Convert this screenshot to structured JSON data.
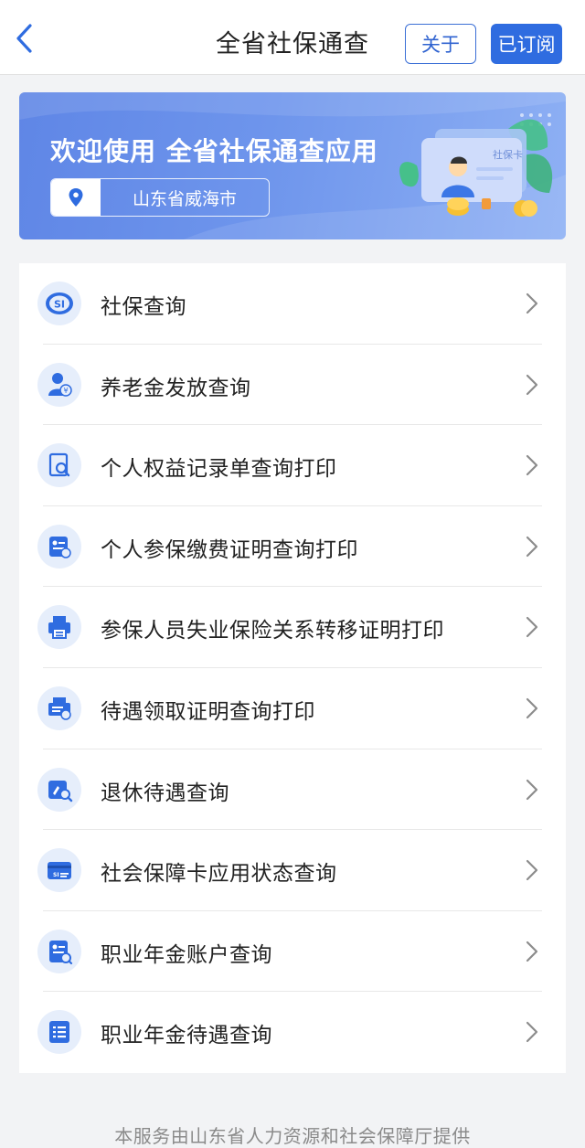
{
  "header": {
    "title": "全省社保通查",
    "about_label": "关于",
    "subscribed_label": "已订阅"
  },
  "banner": {
    "welcome": "欢迎使用 全省社保通查应用",
    "location": "山东省威海市",
    "card_text": "社保卡"
  },
  "colors": {
    "primary": "#2f6ce0",
    "icon_bg": "#e6eefb",
    "icon_fg": "#2f6ce0"
  },
  "menu": [
    {
      "label": "社保查询",
      "icon": "social-security-logo-icon"
    },
    {
      "label": "养老金发放查询",
      "icon": "pension-person-icon"
    },
    {
      "label": "个人权益记录单查询打印",
      "icon": "document-search-icon"
    },
    {
      "label": "个人参保缴费证明查询打印",
      "icon": "payment-certificate-icon"
    },
    {
      "label": "参保人员失业保险关系转移证明打印",
      "icon": "printer-icon"
    },
    {
      "label": "待遇领取证明查询打印",
      "icon": "benefit-printer-icon"
    },
    {
      "label": "退休待遇查询",
      "icon": "retirement-search-icon"
    },
    {
      "label": "社会保障卡应用状态查询",
      "icon": "social-security-card-icon"
    },
    {
      "label": "职业年金账户查询",
      "icon": "annuity-account-icon"
    },
    {
      "label": "职业年金待遇查询",
      "icon": "annuity-list-icon"
    }
  ],
  "footer": {
    "text": "本服务由山东省人力资源和社会保障厅提供"
  }
}
